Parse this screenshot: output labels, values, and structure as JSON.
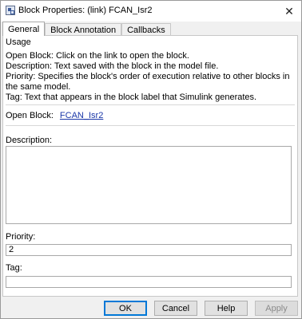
{
  "window": {
    "title": "Block Properties: (link) FCAN_Isr2",
    "close_glyph": "✕"
  },
  "tabs": [
    {
      "label": "General",
      "active": true
    },
    {
      "label": "Block Annotation",
      "active": false
    },
    {
      "label": "Callbacks",
      "active": false
    }
  ],
  "usage": {
    "legend": "Usage",
    "lines": [
      "Open Block: Click on the link to open the block.",
      "Description: Text saved with the block in the model file.",
      "Priority: Specifies the block's order of execution relative to other blocks in the same model.",
      "Tag: Text that appears in the block label that Simulink generates."
    ]
  },
  "open_block": {
    "label": "Open Block:",
    "link_text": "FCAN_Isr2"
  },
  "description": {
    "label": "Description:",
    "value": ""
  },
  "priority": {
    "label": "Priority:",
    "value": "2"
  },
  "tag": {
    "label": "Tag:",
    "value": ""
  },
  "buttons": {
    "ok": "OK",
    "cancel": "Cancel",
    "help": "Help",
    "apply": "Apply"
  }
}
